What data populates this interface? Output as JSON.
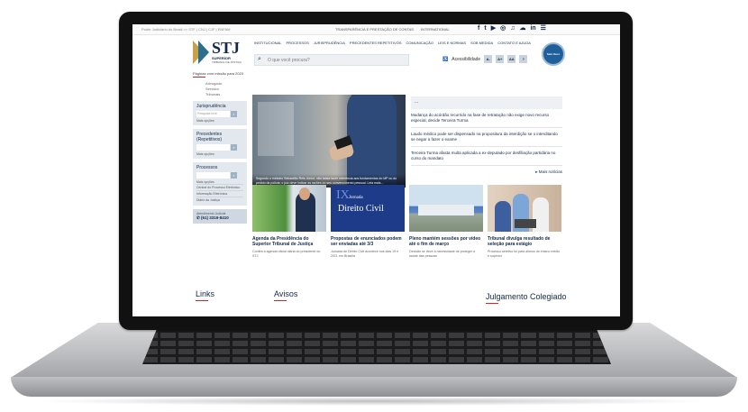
{
  "topbar": {
    "gov": "Poder Judiciário do Brasil >> STF | CNJ | CJF | ENFAM",
    "transparency": "TRANSPARÊNCIA E PRESTAÇÃO DE CONTAS",
    "international": "INTERNATIONAL",
    "social": [
      "f",
      "t",
      "▶",
      "◎",
      "♫",
      "☁",
      "in",
      "☰"
    ]
  },
  "logo": {
    "title": "STJ",
    "sub": "SUPERIOR",
    "sub2": "TRIBUNAL DE JUSTIÇA"
  },
  "nav": [
    "INSTITUCIONAL",
    "PROCESSOS",
    "JURISPRUDÊNCIA",
    "PRECEDENTES REPETITIVOS",
    "COMUNICAÇÃO",
    "LEIS E NORMAS",
    "SOB MEDIDA",
    "CONTATO E AJUDA"
  ],
  "search": {
    "placeholder": "O que você procura?"
  },
  "accessibility": {
    "label": "Acessibilidade",
    "buttons": [
      "A-",
      "A+",
      "AA",
      "?"
    ]
  },
  "seal": {
    "label": "Selo Ouro"
  },
  "sidebar": {
    "top": "Páginas com missão para 2023",
    "links": [
      "Advogado",
      "Servidor",
      "Tribunais"
    ],
    "boxes": [
      {
        "title": "Jurisprudência",
        "placeholder": "Pesquisa livre",
        "more": "Mais opções"
      },
      {
        "title": "Precedentes (Repetitivos)",
        "placeholder": "",
        "more": "Mais opções"
      },
      {
        "title": "Processos",
        "placeholder": "",
        "more": "Mais opções"
      }
    ],
    "extra_links": [
      "Central do Processo Eletrônico",
      "Informação Eletrônica",
      "Diário da Justiça"
    ],
    "service": {
      "label": "Atendimento Judicial",
      "phone": "(61) 3319-8410"
    }
  },
  "hero": {
    "caption": "Segundo o ministro Sebastião Reis Júnior, não basta fazer referência aos fundamentos do MP ou do pedido da polícia; o juiz deve indicar as razões do seu convencimento pessoal. Leia mais..."
  },
  "news": {
    "top": "...",
    "items": [
      "Mudança do acórdão recorrido na fase de retratação não exige novo recurso especial, decide Terceira Turma",
      "Laudo médico pode ser dispensado na propositura da interdição se o interditando se negar a fazer o exame",
      "Terceira Turma afasta multa aplicada a ex-deputado por desfiliação partidária no curso do mandato"
    ],
    "more": "Mais notícias"
  },
  "cards": [
    {
      "title": "Agenda da Presidência do Superior Tribunal de Justiça",
      "desc": "Confira a agenda oficial diária do presidente do STJ"
    },
    {
      "title": "Propostas de enunciados podem ser enviadas até 3/3",
      "desc": "Jornada de Direito Civil acontece nos dias 19 e 20/3, em Brasília",
      "img_big": "IX",
      "img_top": "Jornada",
      "img_text": "Direito Civil"
    },
    {
      "title": "Pleno mantém sessões por vídeo até o fim de março",
      "desc": "Decisão se deve à necessidade de proteger a saúde das pessoas"
    },
    {
      "title": "Tribunal divulga resultado de seleção para estágio",
      "desc": "Processo seletivo foi para alunos do ensino médio e superior"
    }
  ],
  "sections": {
    "links": "Links",
    "avisos": "Avisos",
    "julgamento": "Julgamento Colegiado"
  }
}
